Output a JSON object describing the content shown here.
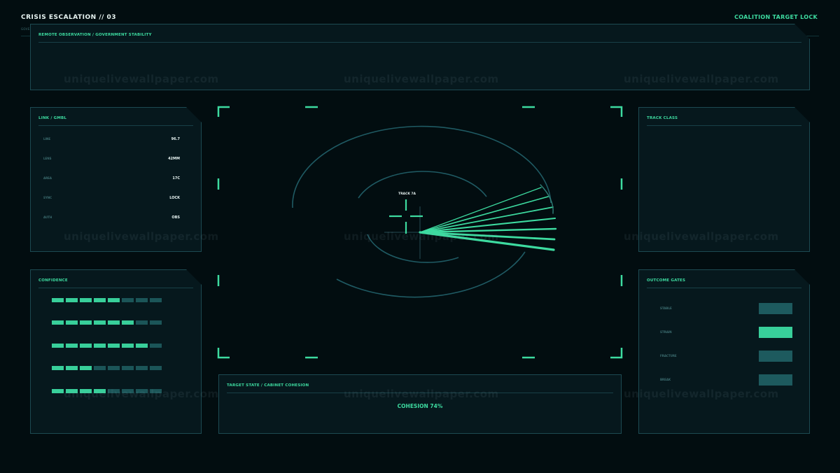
{
  "header": {
    "title": "CRISIS ESCALATION // 03",
    "subtitle": "GOVE",
    "right_label": "COALITION TARGET LOCK"
  },
  "observation_panel": {
    "title": "REMOTE OBSERVATION / GOVERNMENT STABILITY"
  },
  "link_panel": {
    "title": "LINK / GMBL",
    "rows": [
      {
        "key": "LINE",
        "value": "96.7"
      },
      {
        "key": "LENS",
        "value": "42MM"
      },
      {
        "key": "AREA",
        "value": "17C"
      },
      {
        "key": "SYNC",
        "value": "LOCK"
      },
      {
        "key": "AUTH",
        "value": "OBS"
      }
    ]
  },
  "confidence_panel": {
    "title": "CONFIDENCE",
    "rows": [
      5,
      6,
      7,
      3,
      4
    ],
    "segments": 8,
    "colors": {
      "on": "#38cf9a",
      "off": "#1b5558"
    }
  },
  "track_panel": {
    "title": "TRACK CLASS"
  },
  "outcome_panel": {
    "title": "OUTCOME GATES",
    "items": [
      {
        "label": "STABLE",
        "active": false
      },
      {
        "label": "STRAIN",
        "active": true
      },
      {
        "label": "FRACTURE",
        "active": false
      },
      {
        "label": "BREAK",
        "active": false
      }
    ]
  },
  "target_panel": {
    "title": "TARGET STATE / CABINET COHESION",
    "cohesion": "COHESION 74%"
  },
  "scope": {
    "track_label": "TRACK 7A",
    "accent": "#3ddba0",
    "ring_color": "#1f5a63"
  },
  "watermark": "uniquelivewallpaper.com"
}
